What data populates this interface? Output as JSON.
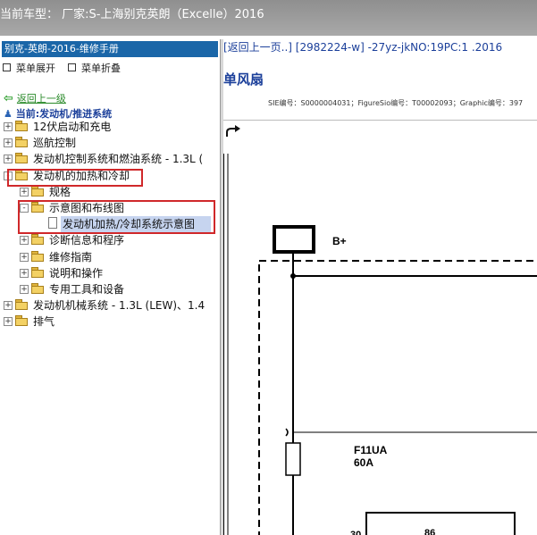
{
  "window": {
    "title": "当前车型： 厂家:S-上海别克英朗（Excelle）2016"
  },
  "left_panel": {
    "header": "别克-英朗-2016-维修手册",
    "expand_label": "菜单展开",
    "collapse_label": "菜单折叠",
    "back_label": "返回上一级",
    "current_path": "当前:发动机/推进系统",
    "tree": [
      {
        "label": "12伏启动和充电",
        "level": 0,
        "type": "folder",
        "expander": "+"
      },
      {
        "label": "巡航控制",
        "level": 0,
        "type": "folder",
        "expander": "+"
      },
      {
        "label": "发动机控制系统和燃油系统 - 1.3L (",
        "level": 0,
        "type": "folder",
        "expander": "+"
      },
      {
        "label": "发动机的加热和冷却",
        "level": 0,
        "type": "folder",
        "expander": "-"
      },
      {
        "label": "规格",
        "level": 1,
        "type": "folder",
        "expander": "+"
      },
      {
        "label": "示意图和布线图",
        "level": 1,
        "type": "folder",
        "expander": "-"
      },
      {
        "label": "发动机加热/冷却系统示意图",
        "level": 2,
        "type": "doc",
        "expander": ""
      },
      {
        "label": "诊断信息和程序",
        "level": 1,
        "type": "folder",
        "expander": "+"
      },
      {
        "label": "维修指南",
        "level": 1,
        "type": "folder",
        "expander": "+"
      },
      {
        "label": "说明和操作",
        "level": 1,
        "type": "folder",
        "expander": "+"
      },
      {
        "label": "专用工具和设备",
        "level": 1,
        "type": "folder",
        "expander": "+"
      },
      {
        "label": "发动机机械系统 - 1.3L (LEW)、1.4",
        "level": 0,
        "type": "folder",
        "expander": "+"
      },
      {
        "label": "排气",
        "level": 0,
        "type": "folder",
        "expander": "+"
      }
    ]
  },
  "right_panel": {
    "top_link": "[返回上一页..] [2982224-w] -27yz-jkNO:19PC:1 .2016",
    "title": "单风扇",
    "meta": "SIE编号：S0000004031；FigureSio编号：T00002093；Graphic编号：397",
    "share_icon": "curved-arrow-icon",
    "diagram_labels": {
      "bplus": "B+",
      "fuse_name": "F11UA",
      "fuse_rating": "60A",
      "pin_30": "30",
      "pin_86": "86"
    }
  },
  "colors": {
    "tree_highlight": "#c6d4ef",
    "annotation_red": "#d0282a",
    "header_blue": "#1a66a8"
  }
}
